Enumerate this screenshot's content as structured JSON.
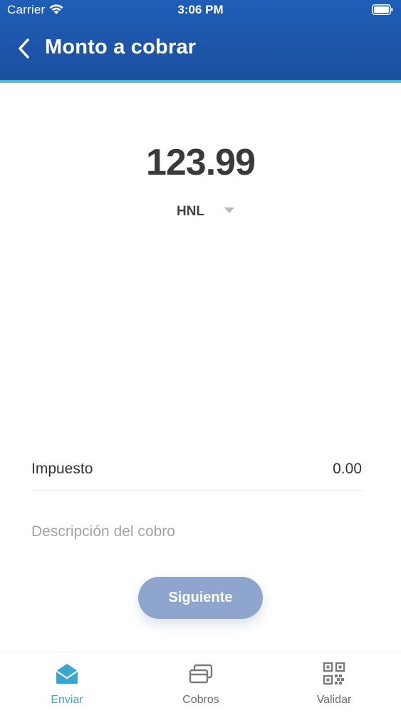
{
  "status_bar": {
    "carrier": "Carrier",
    "time": "3:06 PM"
  },
  "nav": {
    "title": "Monto a cobrar"
  },
  "amount": {
    "value": "123.99",
    "currency": "HNL"
  },
  "tax": {
    "label": "Impuesto",
    "value": "0.00"
  },
  "description": {
    "value": "",
    "placeholder": "Descripción del cobro"
  },
  "actions": {
    "next_label": "Siguiente"
  },
  "tabs": [
    {
      "label": "Enviar",
      "icon": "envelope-icon",
      "active": true
    },
    {
      "label": "Cobros",
      "icon": "cards-stack-icon",
      "active": false
    },
    {
      "label": "Validar",
      "icon": "qr-code-icon",
      "active": false
    }
  ],
  "colors": {
    "header": "#1f5fb8",
    "accent": "#4db7d6",
    "button": "#8ea6cd",
    "active_tab": "#3aa6cc"
  }
}
